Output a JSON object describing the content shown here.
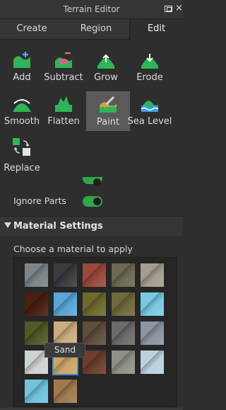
{
  "window": {
    "title": "Terrain Editor",
    "close_glyph": "×"
  },
  "tabs": [
    {
      "label": "Create",
      "selected": false
    },
    {
      "label": "Region",
      "selected": false
    },
    {
      "label": "Edit",
      "selected": true
    }
  ],
  "tools": [
    {
      "label": "Add",
      "icon": "terrain-add-icon"
    },
    {
      "label": "Subtract",
      "icon": "terrain-subtract-icon"
    },
    {
      "label": "Grow",
      "icon": "terrain-grow-icon"
    },
    {
      "label": "Erode",
      "icon": "terrain-erode-icon"
    },
    {
      "label": "Smooth",
      "icon": "terrain-smooth-icon"
    },
    {
      "label": "Flatten",
      "icon": "terrain-flatten-icon"
    },
    {
      "label": "Paint",
      "icon": "terrain-paint-icon",
      "selected": true
    },
    {
      "label": "Sea Level",
      "icon": "terrain-sea-level-icon"
    },
    {
      "label": "Replace",
      "icon": "terrain-replace-icon"
    }
  ],
  "options": {
    "ignore_parts_label": "Ignore Parts",
    "ignore_parts_on": true
  },
  "material_settings": {
    "header": "Material Settings",
    "instruction": "Choose a material to apply",
    "tooltip": "Sand",
    "selected": "Sand",
    "materials": [
      {
        "color": "#7d8588"
      },
      {
        "color": "#3b3b40"
      },
      {
        "color": "#9a4a3a"
      },
      {
        "color": "#6b6a52"
      },
      {
        "color": "#a59d8f"
      },
      {
        "color": "#4a1f14"
      },
      {
        "color": "#5aa6d8"
      },
      {
        "color": "#6e6a2d"
      },
      {
        "color": "#6f6a3c"
      },
      {
        "color": "#79c9e4"
      },
      {
        "color": "#4f5a25"
      },
      {
        "color": "#c9ad7c"
      },
      {
        "color": "#5f4e3a"
      },
      {
        "color": "#6b6b6b"
      },
      {
        "color": "#8b95a2"
      },
      {
        "color": "#cfd2d3"
      },
      {
        "color": "#c9a66a"
      },
      {
        "color": "#6e3e2d"
      },
      {
        "color": "#8f9189"
      },
      {
        "color": "#bcd2e0"
      },
      {
        "color": "#6fc3dd"
      },
      {
        "color": "#a07a4f"
      }
    ]
  },
  "colors": {
    "toggle_on": "#2fa74d",
    "selection_outline": "#3d8fd6",
    "terrain_green": "#2fb457"
  }
}
